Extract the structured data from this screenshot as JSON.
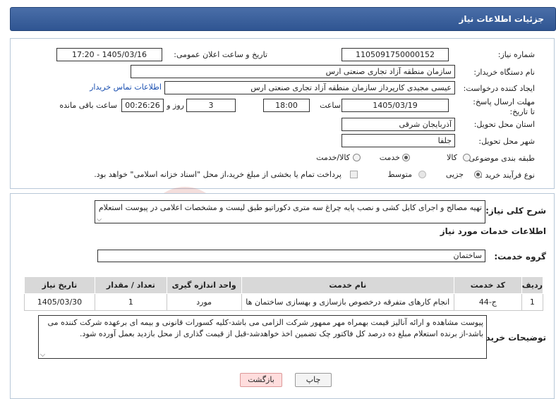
{
  "header": {
    "title": "جزئیات اطلاعات نیاز"
  },
  "need_number": {
    "label": "شماره نیاز:",
    "value": "1105091750000152"
  },
  "announce_datetime": {
    "label": "تاریخ و ساعت اعلان عمومی:",
    "value": "1405/03/16 - 17:20"
  },
  "buyer_org": {
    "label": "نام دستگاه خریدار:",
    "value": "سازمان منطقه آزاد تجاری صنعتی ارس"
  },
  "requester": {
    "label": "ایجاد کننده درخواست:",
    "value": "عیسی مجیدی کارپرداز سازمان منطقه آزاد تجاری صنعتی ارس",
    "contact_link": "اطلاعات تماس خریدار"
  },
  "deadline": {
    "label": "مهلت ارسال پاسخ: تا تاریخ:",
    "date": "1405/03/19",
    "time_label": "ساعت",
    "time": "18:00",
    "days": "3",
    "days_label": "روز و",
    "remaining": "00:26:26",
    "remaining_label": "ساعت باقی مانده"
  },
  "province": {
    "label": "استان محل تحویل:",
    "value": "آذربایجان شرقی"
  },
  "city": {
    "label": "شهر محل تحویل:",
    "value": "جلفا"
  },
  "category": {
    "label": "طبقه بندی موضوعی:",
    "options": [
      "کالا",
      "خدمت",
      "کالا/خدمت"
    ],
    "selected": "خدمت"
  },
  "purchase_type": {
    "label": "نوع فرآیند خرید :",
    "options": [
      "جزیی",
      "متوسط"
    ],
    "selected": "جزیی",
    "payment_note": "پرداخت تمام یا بخشی از مبلغ خرید،از محل \"اسناد خزانه اسلامی\" خواهد بود."
  },
  "general_description": {
    "label": "شرح کلی نیاز:",
    "value": "تهیه مصالح و اجرای کابل کشی و نصب پایه چراغ سه متری دکوراتیو طبق لیست و مشخصات اعلامی در پیوست استعلام"
  },
  "services_section": {
    "title": "اطلاعات خدمات مورد نیاز"
  },
  "service_group": {
    "label": "گروه خدمت:",
    "value": "ساختمان"
  },
  "service_table": {
    "headers": [
      "ردیف",
      "کد خدمت",
      "نام خدمت",
      "واحد اندازه گیری",
      "تعداد / مقدار",
      "تاریخ نیاز"
    ],
    "rows": [
      [
        "1",
        "ج-44",
        "انجام کارهای متفرقه درخصوص بازسازی و بهسازی ساختمان ها",
        "مورد",
        "1",
        "1405/03/30"
      ]
    ]
  },
  "buyer_notes": {
    "label": "توضیحات خریدار:",
    "value": "پیوست مشاهده و ارائه آنالیز قیمت بهمراه مهر ممهور شرکت الزامی می باشد-کلیه کسورات قانونی و بیمه ای برعهده شرکت کننده می باشد-از برنده استعلام مبلغ ده درصد کل فاکتور چک تضمین اخذ خواهدشد-قبل از قیمت گذاری از محل بازدید بعمل آورده شود."
  },
  "buttons": {
    "print": "چاپ",
    "back": "بازگشت"
  },
  "colors": {
    "header": "#2f5592",
    "link": "#1a4fb0",
    "watermark": "#c0392b"
  }
}
